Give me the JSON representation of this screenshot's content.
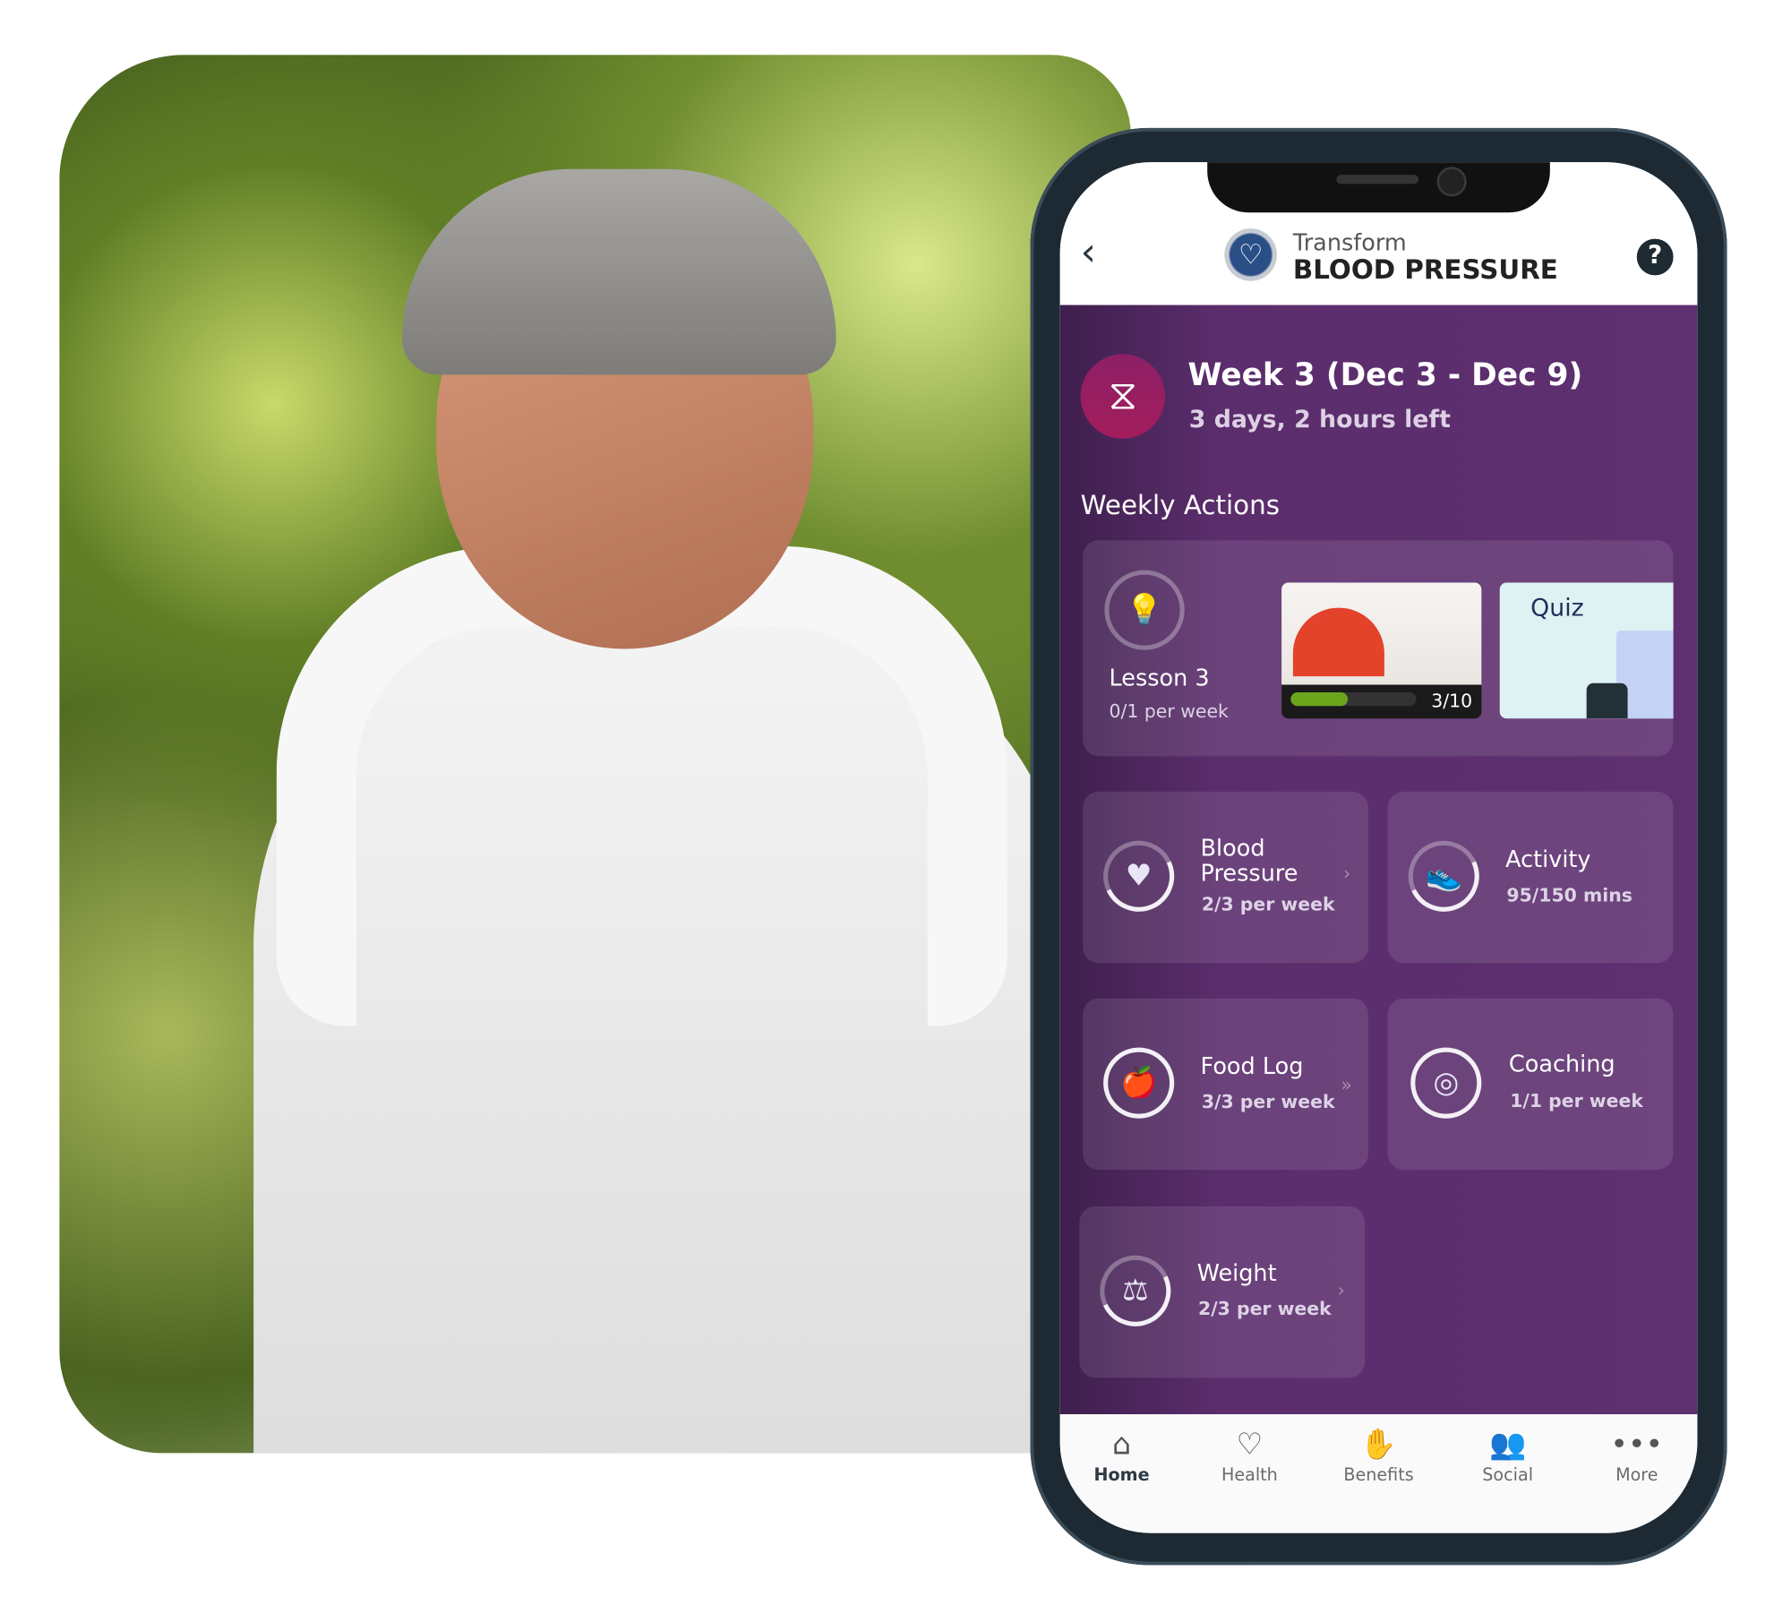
{
  "header": {
    "brand_line1": "Transform",
    "brand_line2": "BLOOD PRESSURE",
    "back_icon": "chevron-left-icon",
    "help_icon": "help-icon"
  },
  "week": {
    "title": "Week 3 (Dec 3 - Dec 9)",
    "remaining": "3 days, 2 hours left",
    "icon": "hourglass-icon",
    "accent": "#a31d5c"
  },
  "section_title": "Weekly Actions",
  "lesson": {
    "title": "Lesson 3",
    "progress": "0/1 per week",
    "video_progress": "3/10",
    "video_progress_fraction": 0.3,
    "quiz_label": "Quiz"
  },
  "actions": [
    {
      "title": "Blood Pressure",
      "progress": "2/3 per week",
      "icon": "blood-pressure-icon"
    },
    {
      "title": "Activity",
      "progress": "95/150 mins",
      "icon": "shoe-icon"
    },
    {
      "title": "Food Log",
      "progress": "3/3 per week",
      "icon": "apple-icon"
    },
    {
      "title": "Coaching",
      "progress": "1/1 per week",
      "icon": "target-icon"
    },
    {
      "title": "Weight",
      "progress": "2/3 per week",
      "icon": "scale-icon"
    }
  ],
  "nav": [
    {
      "label": "Home",
      "icon": "home-icon",
      "active": true
    },
    {
      "label": "Health",
      "icon": "heart-icon"
    },
    {
      "label": "Benefits",
      "icon": "benefits-icon"
    },
    {
      "label": "Social",
      "icon": "people-icon"
    },
    {
      "label": "More",
      "icon": "more-icon"
    }
  ],
  "colors": {
    "purple": "#5e3070",
    "progress_green": "#6aa51c"
  }
}
